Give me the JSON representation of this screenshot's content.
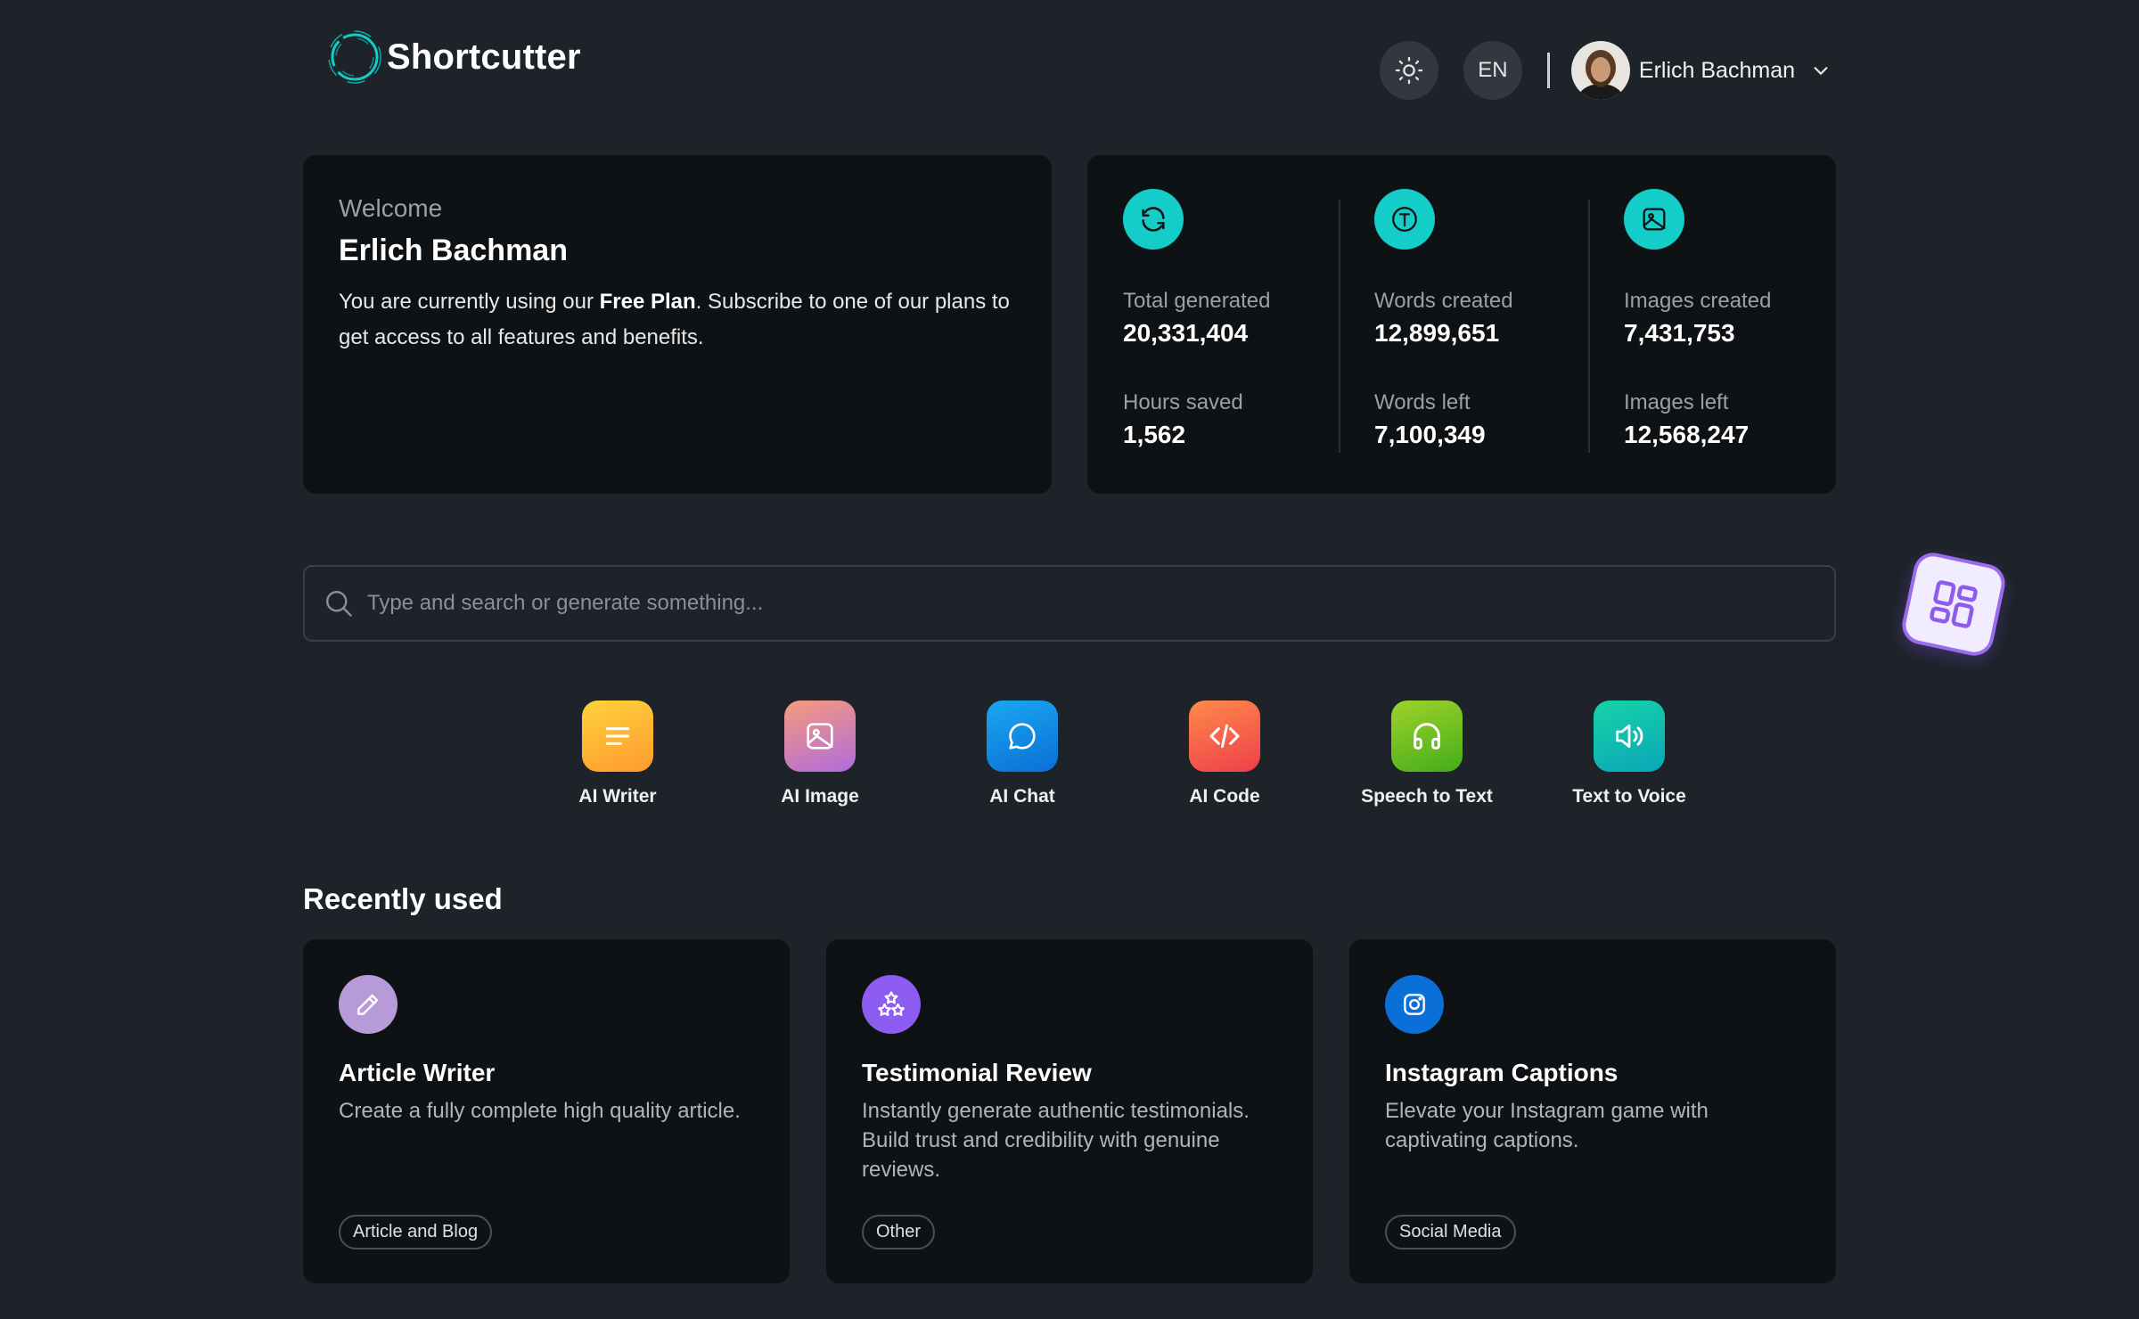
{
  "app": {
    "name": "Shortcutter"
  },
  "header": {
    "theme_icon": "sun-icon",
    "language": "EN",
    "user_name": "Erlich Bachman"
  },
  "welcome": {
    "label": "Welcome",
    "name": "Erlich Bachman",
    "text_before": "You are currently using our ",
    "plan": "Free Plan",
    "text_after": ". Subscribe to one of our plans to get access to all features and benefits."
  },
  "stats": [
    {
      "icon": "refresh-icon",
      "label1": "Total generated",
      "value1": "20,331,404",
      "label2": "Hours saved",
      "value2": "1,562"
    },
    {
      "icon": "text-t-icon",
      "label1": "Words created",
      "value1": "12,899,651",
      "label2": "Words left",
      "value2": "7,100,349"
    },
    {
      "icon": "image-icon",
      "label1": "Images created",
      "value1": "7,431,753",
      "label2": "Images left",
      "value2": "12,568,247"
    }
  ],
  "search": {
    "placeholder": "Type and search or generate something..."
  },
  "tools": [
    {
      "label": "AI Writer",
      "icon": "lines-icon",
      "color": "#ffb02e"
    },
    {
      "label": "AI Image",
      "icon": "image-icon",
      "color": "#d77ac0"
    },
    {
      "label": "AI Chat",
      "icon": "chat-bubble-icon",
      "color": "#0b86e6"
    },
    {
      "label": "AI Code",
      "icon": "code-icon",
      "color": "#f0553d"
    },
    {
      "label": "Speech to Text",
      "icon": "headphones-icon",
      "color": "#6cc21a"
    },
    {
      "label": "Text to Voice",
      "icon": "speaker-icon",
      "color": "#16c3a0"
    }
  ],
  "recent": {
    "title": "Recently used",
    "items": [
      {
        "title": "Article Writer",
        "desc": "Create a fully complete high quality article.",
        "tag": "Article and Blog",
        "icon": "pencil-icon",
        "color": "#b79bd9"
      },
      {
        "title": "Testimonial Review",
        "desc": "Instantly generate authentic testimonials. Build trust and credibility with genuine reviews.",
        "tag": "Other",
        "icon": "stars-icon",
        "color": "#8d5cf0"
      },
      {
        "title": "Instagram Captions",
        "desc": "Elevate your Instagram game with captivating captions.",
        "tag": "Social Media",
        "icon": "instagram-icon",
        "color": "#0b6fd8"
      }
    ]
  }
}
